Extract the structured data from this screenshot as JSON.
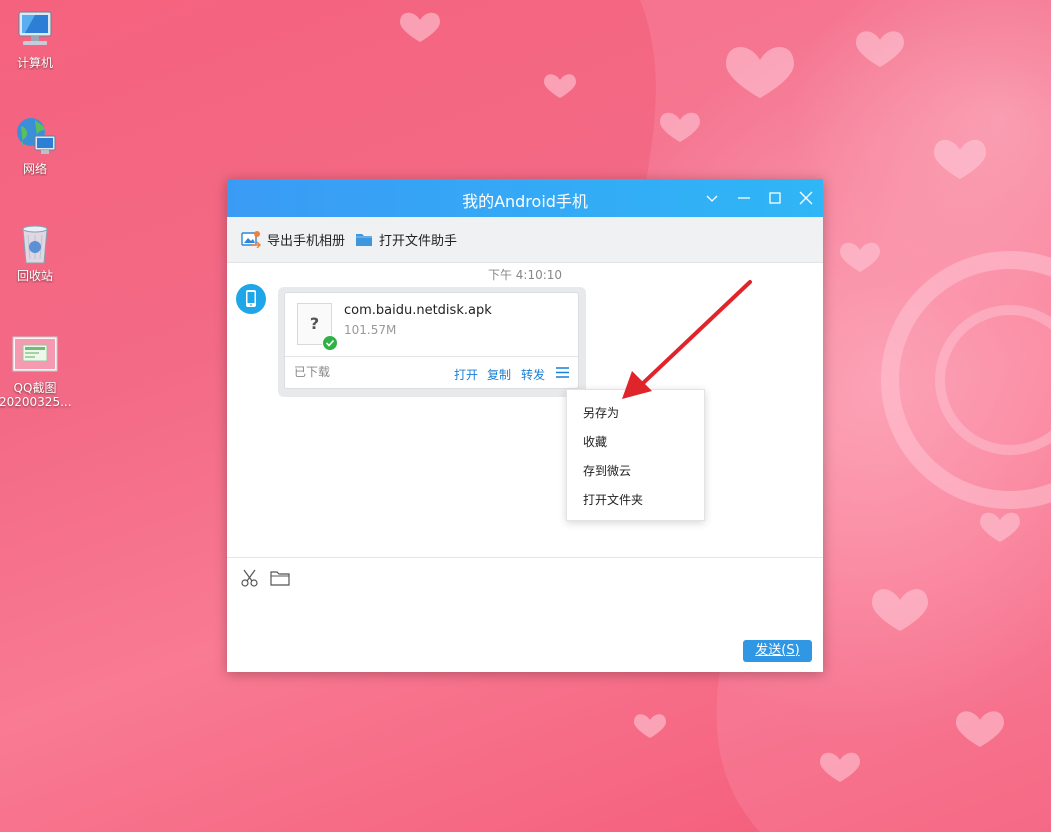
{
  "desktop": {
    "icons": [
      {
        "label": "计算机",
        "icon": "computer-icon"
      },
      {
        "label": "网络",
        "icon": "network-icon"
      },
      {
        "label": "回收站",
        "icon": "recycle-bin-icon"
      },
      {
        "label": "QQ截图 20200325...",
        "icon": "image-file-icon"
      }
    ]
  },
  "window": {
    "title": "我的Android手机",
    "controls": [
      "chevron-down-icon",
      "minimize-icon",
      "maximize-icon",
      "close-icon"
    ],
    "accent": "#2fb6f6"
  },
  "toolbar": {
    "export_album": "导出手机相册",
    "open_file_helper": "打开文件助手"
  },
  "chat": {
    "timestamp": "下午 4:10:10",
    "file": {
      "name": "com.baidu.netdisk.apk",
      "size": "101.57M",
      "icon_glyph": "?",
      "status": "已下载",
      "actions": {
        "open": "打开",
        "copy": "复制",
        "forward": "转发"
      }
    }
  },
  "context_menu": {
    "items": [
      "另存为",
      "收藏",
      "存到微云",
      "打开文件夹"
    ]
  },
  "input": {
    "tools": [
      "scissors-icon",
      "folder-icon"
    ],
    "send_label": "发送(S)"
  }
}
